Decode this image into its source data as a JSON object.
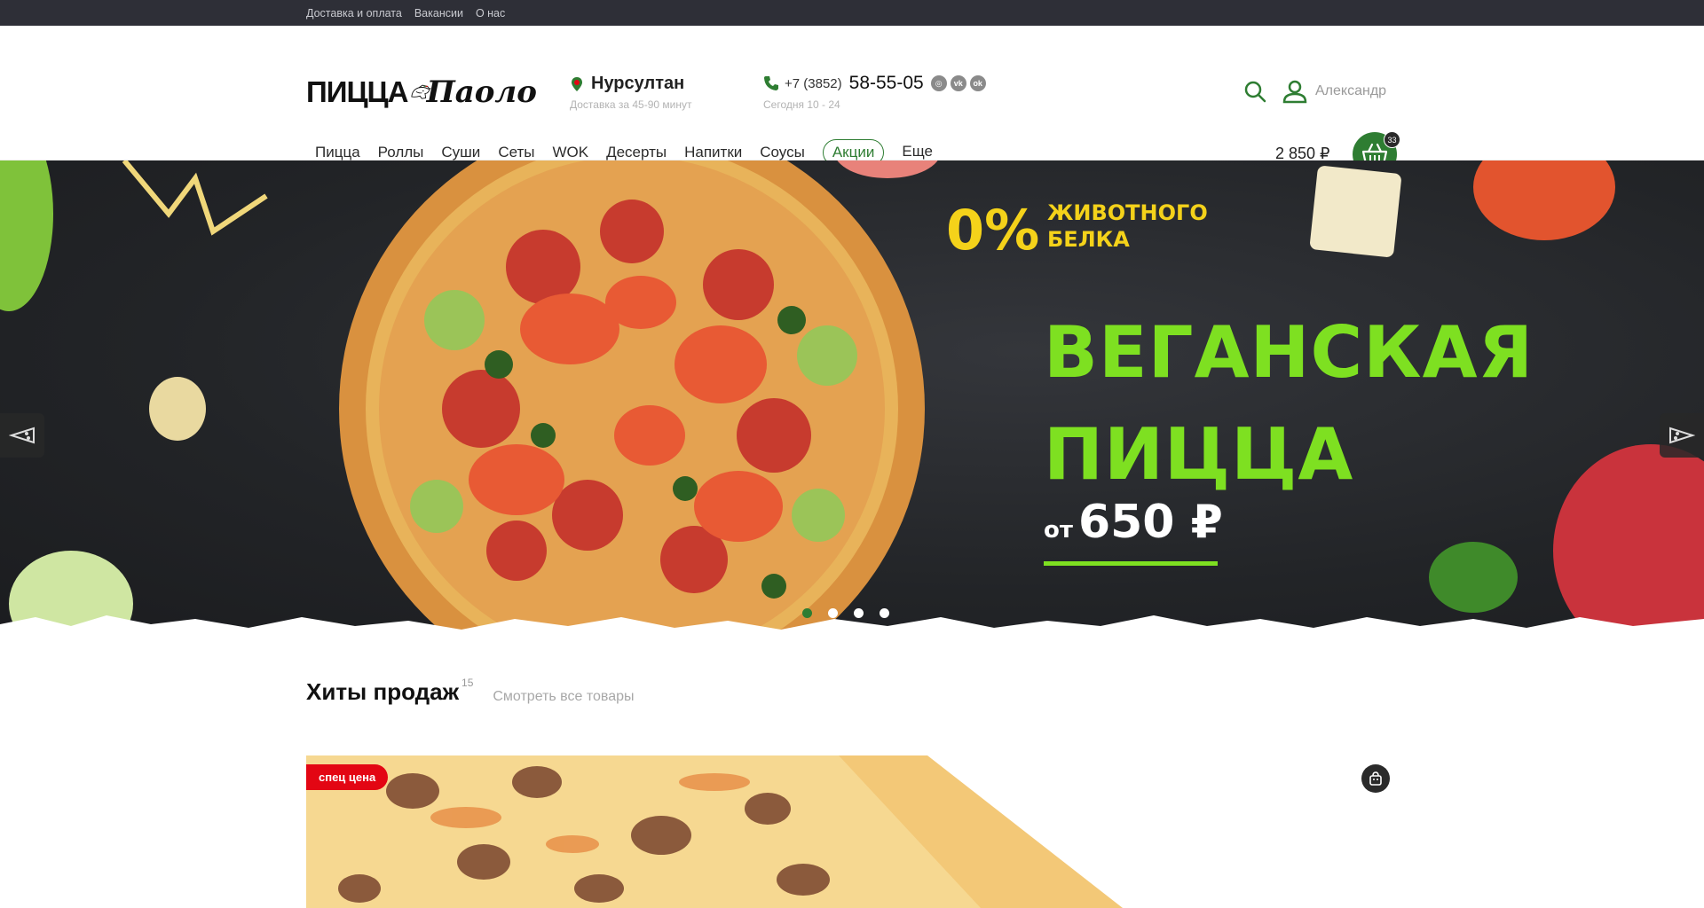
{
  "topbar": {
    "links": [
      "Доставка и оплата",
      "Вакансии",
      "О нас"
    ]
  },
  "logo": {
    "part1": "ПИЦЦА",
    "part2": "Паоло"
  },
  "city": {
    "name": "Нурсултан",
    "delivery": "Доставка за 45-90 минут"
  },
  "phone": {
    "code": "+7 (3852)",
    "number": "58-55-05",
    "hours": "Сегодня 10 - 24"
  },
  "social": [
    "instagram-icon",
    "vk-icon",
    "ok-icon"
  ],
  "user": {
    "name": "Александр"
  },
  "nav": {
    "items": [
      "Пицца",
      "Роллы",
      "Суши",
      "Сеты",
      "WOK",
      "Десерты",
      "Напитки",
      "Соусы"
    ],
    "promo": "Акции",
    "more": "Еще"
  },
  "cart": {
    "total": "2 850 ₽",
    "count": "33"
  },
  "banner": {
    "zero": "0%",
    "zero_line1": "ЖИВОТНОГО",
    "zero_line2": "БЕЛКА",
    "line1": "ВЕГАНСКАЯ",
    "line2": "ПИЦЦА",
    "price_prefix": "от",
    "price": "650 ₽",
    "slides": 4,
    "active_slide": 1
  },
  "hits": {
    "title": "Хиты продаж",
    "count": "15",
    "link": "Смотреть все товары"
  },
  "product": {
    "tag": "спец цена"
  },
  "colors": {
    "brand_green": "#2e7d32",
    "banner_green": "#7ee021",
    "banner_yellow": "#f4d21a",
    "tag_red": "#e30613",
    "topbar": "#2e2f37"
  }
}
